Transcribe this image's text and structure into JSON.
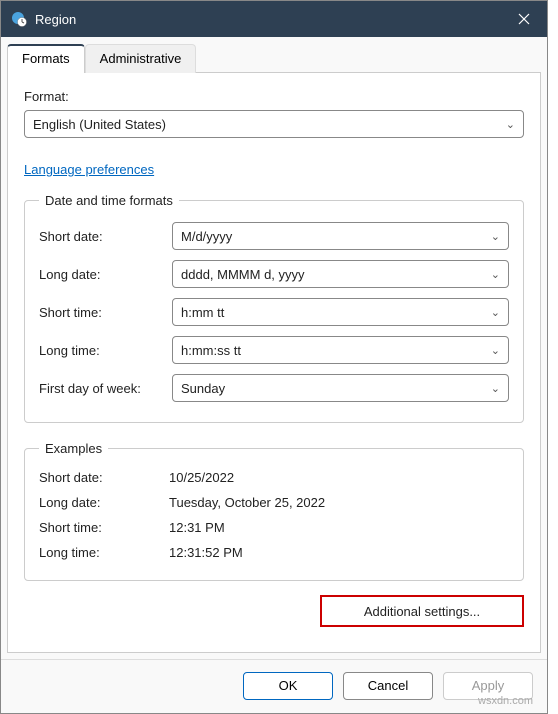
{
  "window": {
    "title": "Region"
  },
  "tabs": {
    "formats": "Formats",
    "administrative": "Administrative"
  },
  "format": {
    "label": "Format:",
    "value": "English (United States)"
  },
  "language_prefs_link": "Language preferences",
  "date_time_formats": {
    "legend": "Date and time formats",
    "short_date_label": "Short date:",
    "short_date_value": "M/d/yyyy",
    "long_date_label": "Long date:",
    "long_date_value": "dddd, MMMM d, yyyy",
    "short_time_label": "Short time:",
    "short_time_value": "h:mm tt",
    "long_time_label": "Long time:",
    "long_time_value": "h:mm:ss tt",
    "first_day_label": "First day of week:",
    "first_day_value": "Sunday"
  },
  "examples": {
    "legend": "Examples",
    "short_date_label": "Short date:",
    "short_date_value": "10/25/2022",
    "long_date_label": "Long date:",
    "long_date_value": "Tuesday, October 25, 2022",
    "short_time_label": "Short time:",
    "short_time_value": "12:31 PM",
    "long_time_label": "Long time:",
    "long_time_value": "12:31:52 PM"
  },
  "additional_settings_label": "Additional settings...",
  "footer": {
    "ok": "OK",
    "cancel": "Cancel",
    "apply": "Apply"
  },
  "watermark": "wsxdn.com"
}
